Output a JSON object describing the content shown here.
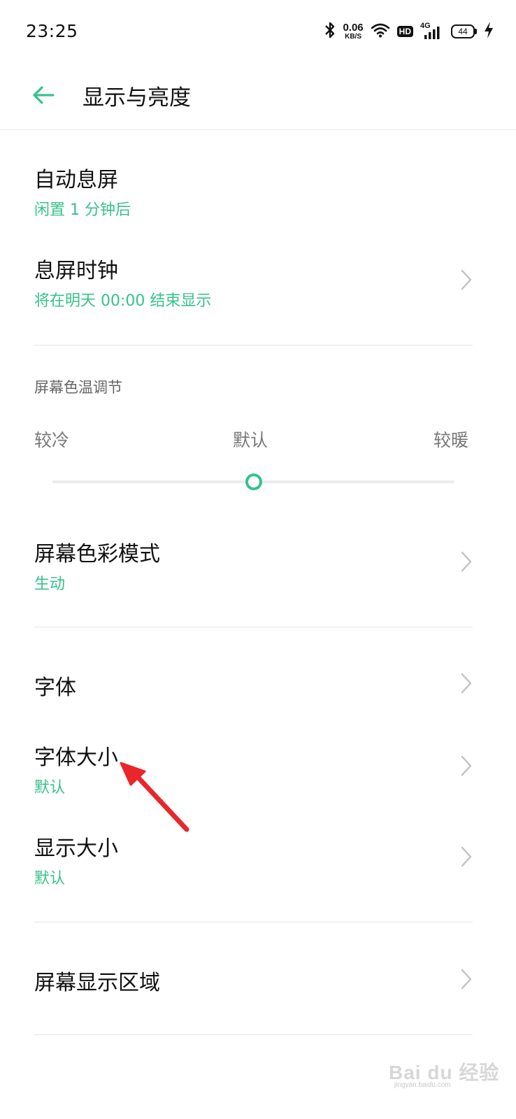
{
  "status_bar": {
    "time": "23:25",
    "net_speed_value": "0.06",
    "net_speed_unit": "KB/S",
    "hd_label": "HD",
    "network_type": "4G",
    "battery_level": "44",
    "icons": [
      "bluetooth-icon",
      "wifi-icon",
      "signal-icon",
      "charging-icon"
    ]
  },
  "header": {
    "title": "显示与亮度",
    "back_icon": "arrow-left-icon"
  },
  "settings": {
    "auto_sleep": {
      "title": "自动息屏",
      "subtitle": "闲置 1 分钟后"
    },
    "aod_clock": {
      "title": "息屏时钟",
      "subtitle": "将在明天  00:00 结束显示"
    },
    "color_temp": {
      "header": "屏幕色温调节",
      "cooler": "较冷",
      "default": "默认",
      "warmer": "较暖",
      "value_fraction": 0.5
    },
    "color_mode": {
      "title": "屏幕色彩模式",
      "subtitle": "生动"
    },
    "font": {
      "title": "字体"
    },
    "font_size": {
      "title": "字体大小",
      "subtitle": "默认"
    },
    "display_size": {
      "title": "显示大小",
      "subtitle": "默认"
    },
    "screen_area": {
      "title": "屏幕显示区域"
    }
  },
  "watermark": {
    "brand": "Bai du 经验",
    "url": "jingyan.baidu.com"
  },
  "colors": {
    "accent": "#37c28a",
    "annotation_arrow": "#e8262b",
    "text_primary": "#111111",
    "text_secondary": "#777777",
    "divider": "#e6e6e6"
  }
}
